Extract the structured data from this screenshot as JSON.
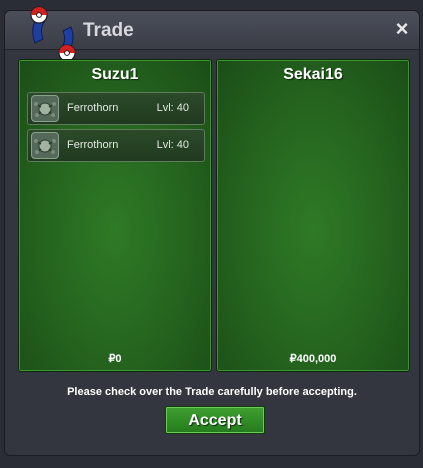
{
  "window": {
    "title": "Trade",
    "close_label": "×"
  },
  "left_panel": {
    "player_name": "Suzu1",
    "items": [
      {
        "name": "Ferrothorn",
        "level": "Lvl: 40",
        "icon": "ferrothorn-icon"
      },
      {
        "name": "Ferrothorn",
        "level": "Lvl: 40",
        "icon": "ferrothorn-icon"
      }
    ],
    "money": "₽0"
  },
  "right_panel": {
    "player_name": "Sekai16",
    "items": [],
    "money": "₽400,000"
  },
  "notice": "Please check over the Trade carefully before accepting.",
  "accept_label": "Accept",
  "colors": {
    "panel_green": "#24631e",
    "accept_green": "#2f8c23",
    "window_bg": "#33363f"
  }
}
